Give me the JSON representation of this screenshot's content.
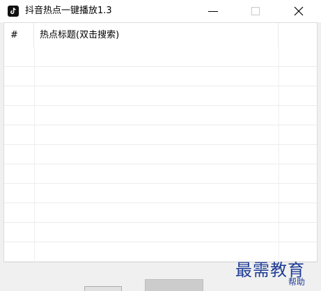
{
  "window": {
    "title": "抖音热点一键播放1.3"
  },
  "icons": {
    "app": "tiktok-icon",
    "minimize": "minimize-icon",
    "maximize": "maximize-icon",
    "close": "close-icon"
  },
  "list": {
    "columns": [
      "#",
      "热点标题(双击搜索)",
      ""
    ],
    "rows": []
  },
  "watermark": {
    "main": "最需教育",
    "sub": "帮助"
  },
  "colors": {
    "watermark": "#1f3c95",
    "window_bg": "#f0f0f0"
  }
}
